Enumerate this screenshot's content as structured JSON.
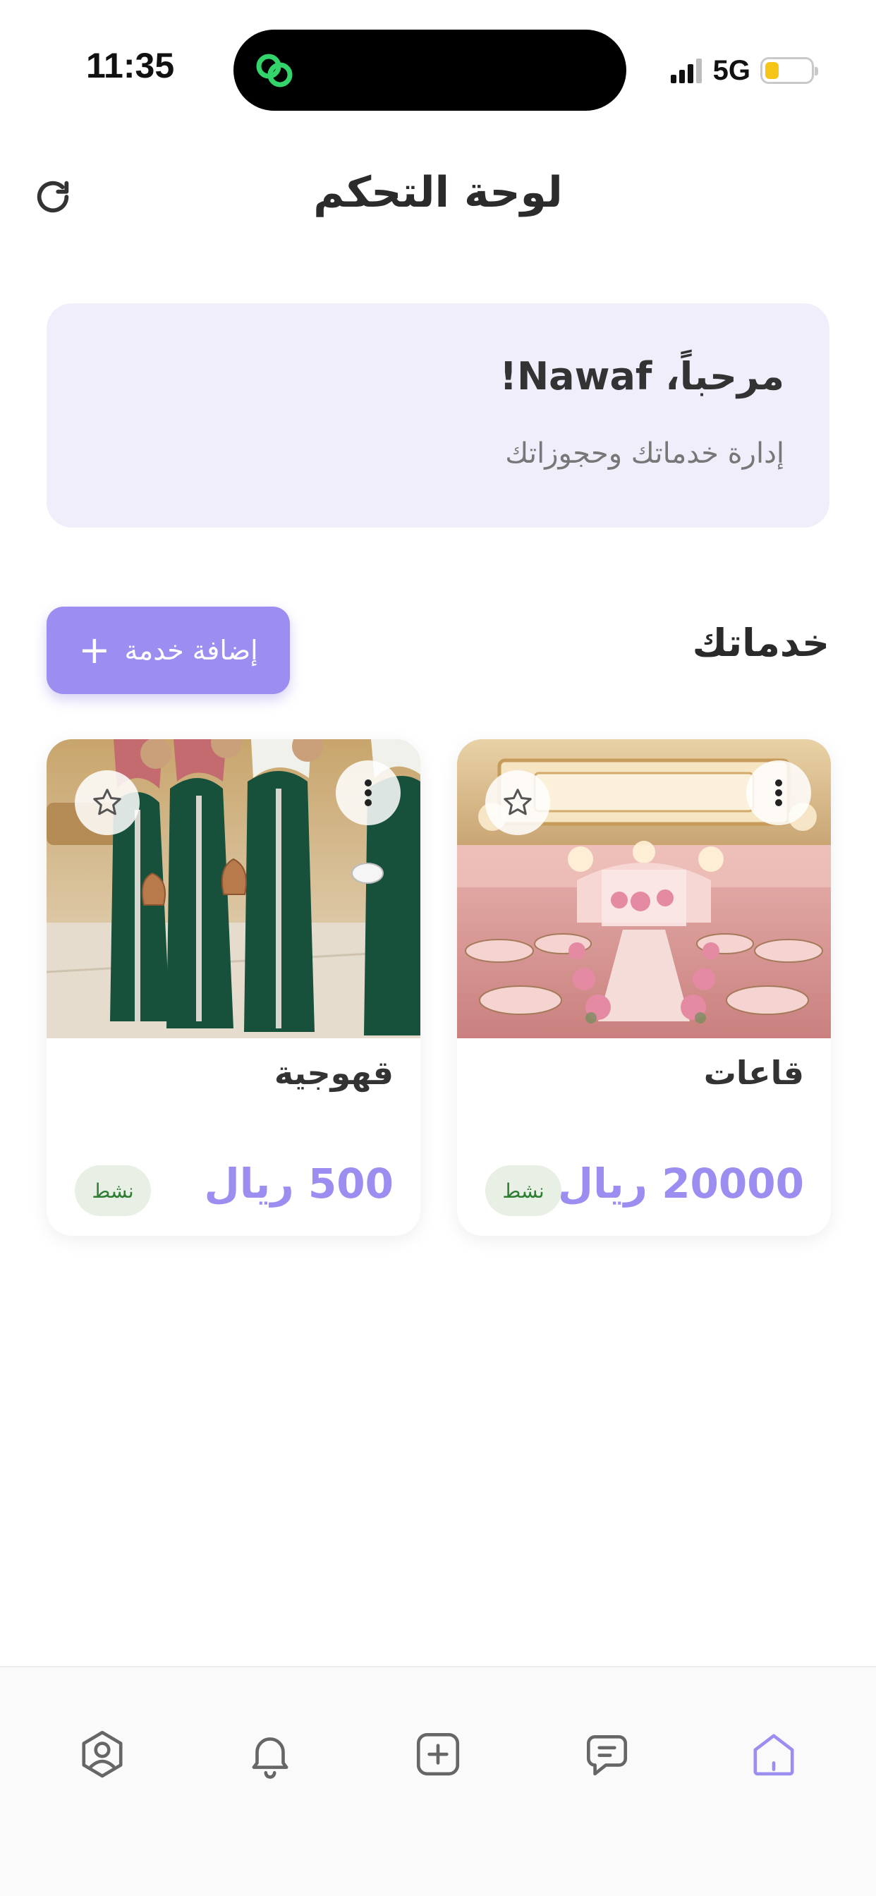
{
  "status_bar": {
    "time": "11:35",
    "network": "5G",
    "battery_level": 0.3
  },
  "header": {
    "title": "لوحة التحكم",
    "refresh_icon": "refresh-icon"
  },
  "welcome": {
    "title": "مرحباً، Nawaf!",
    "subtitle": "إدارة خدماتك وحجوزاتك"
  },
  "services_section": {
    "title": "خدماتك",
    "add_button_label": "إضافة خدمة",
    "add_button_icon": "plus-icon"
  },
  "services": [
    {
      "name": "قاعات",
      "price": "20000 ريال",
      "status": "نشط",
      "image": "wedding-hall-photo"
    },
    {
      "name": "قهوجية",
      "price": "500 ريال",
      "status": "نشط",
      "image": "coffee-servers-photo"
    }
  ],
  "bottom_nav": {
    "items": [
      {
        "icon": "profile-icon",
        "active": false
      },
      {
        "icon": "bell-icon",
        "active": false
      },
      {
        "icon": "add-square-icon",
        "active": false
      },
      {
        "icon": "chat-icon",
        "active": false
      },
      {
        "icon": "home-icon",
        "active": true
      }
    ]
  },
  "colors": {
    "accent": "#9b8ef0",
    "welcome_bg": "#f1eefc",
    "status_badge_bg": "#e8f0e6",
    "status_badge_text": "#2e7d32"
  }
}
